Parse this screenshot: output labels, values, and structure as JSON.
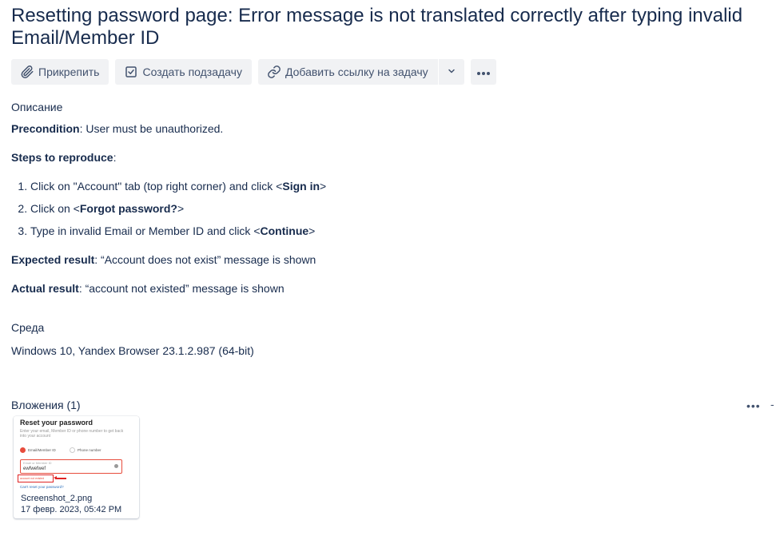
{
  "issue": {
    "title": "Resetting password page: Error message is not translated correctly after typing invalid Email/Member ID"
  },
  "toolbar": {
    "attach_label": "Прикрепить",
    "subtask_label": "Создать подзадачу",
    "link_label": "Добавить ссылку на задачу"
  },
  "description": {
    "heading": "Описание",
    "precondition_label": "Precondition",
    "precondition_text": ": User must be unauthorized.",
    "steps_label": "Steps to reproduce",
    "steps_suffix": ":",
    "step1_text": "Click on \"Account\" tab (top right corner) and click <",
    "step1_bold": "Sign in",
    "step1_end": ">",
    "step2_text": "Click on <",
    "step2_bold": "Forgot password?",
    "step2_end": ">",
    "step3_text": "Type in invalid Email or Member ID and click <",
    "step3_bold": "Continue",
    "step3_end": ">",
    "expected_label": "Expected result",
    "expected_text": ": “Account does not exist” message is shown",
    "actual_label": "Actual result",
    "actual_text": ": “account not existed” message is shown"
  },
  "environment": {
    "heading": "Среда",
    "value": "Windows 10, Yandex Browser 23.1.2.987 (64-bit)"
  },
  "attachments": {
    "heading": "Вложения (1)",
    "items": [
      {
        "file_name": "Screenshot_2.png",
        "date": "17 февр. 2023, 05:42 PM",
        "thumb_title": "Reset your password",
        "thumb_subtitle": "Enter your email, Member ID or phone number to get back into your account",
        "thumb_opt1": "Email/Member ID",
        "thumb_opt2": "Phone number",
        "thumb_field_label": "Email or Member ID",
        "thumb_field_value": "ewfwefwef",
        "thumb_error": "account not existed",
        "thumb_link": "Can't reset your password?"
      }
    ]
  }
}
